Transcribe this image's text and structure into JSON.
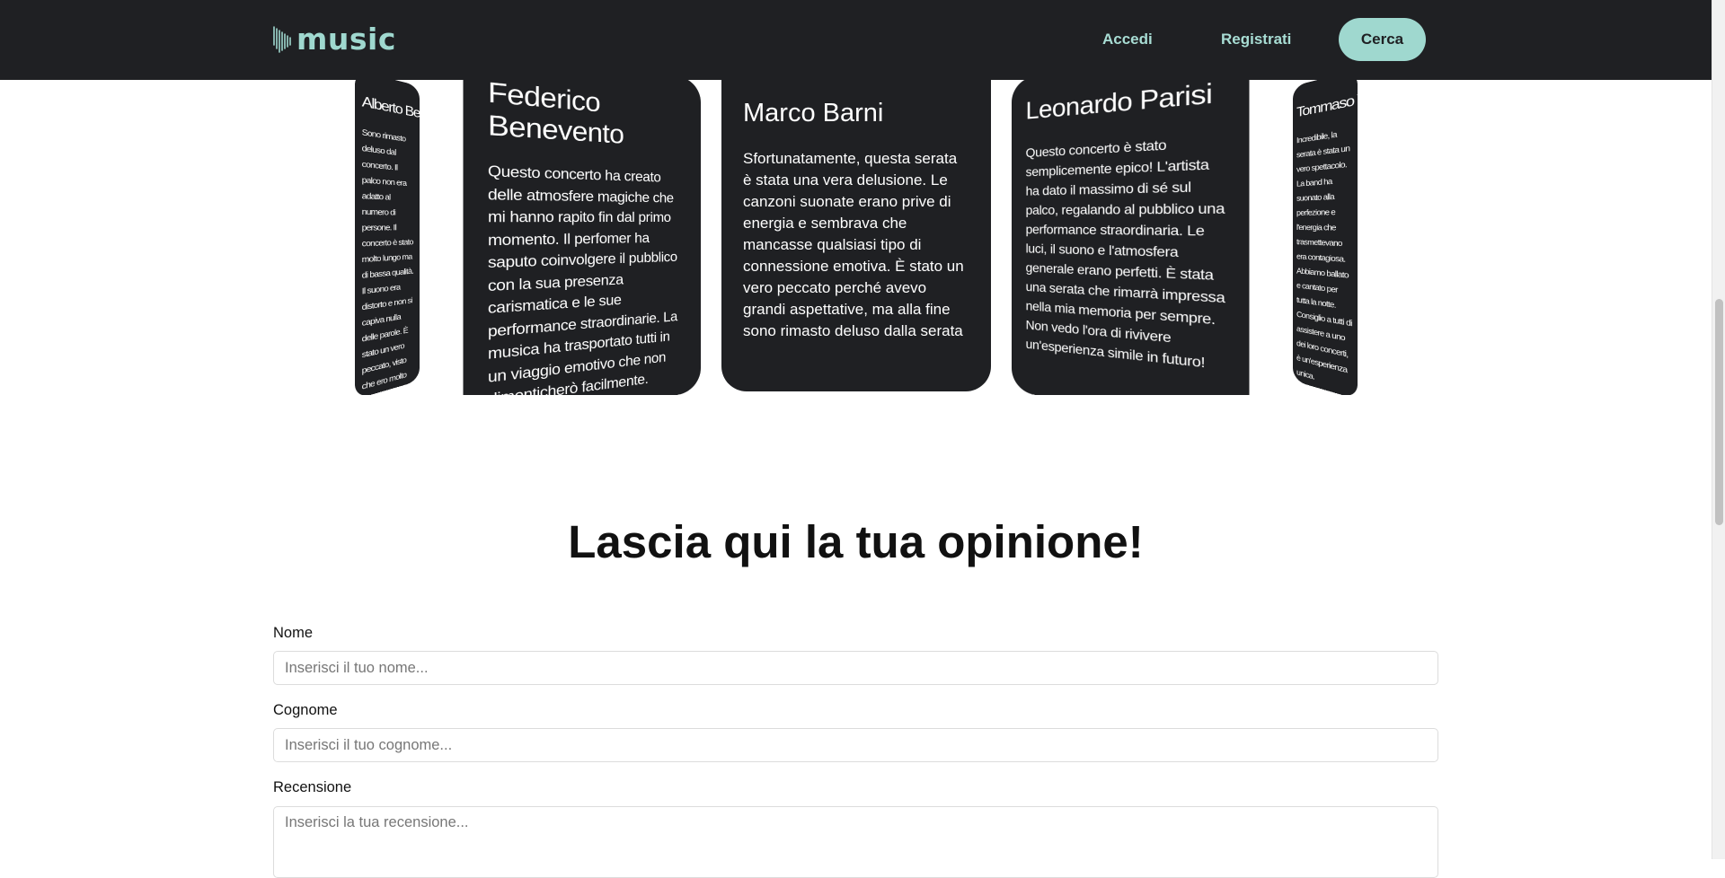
{
  "header": {
    "logo_text": "music",
    "logo_icon": "soundwave-icon",
    "nav_login": "Accedi",
    "nav_register": "Registrati",
    "search_button": "Cerca"
  },
  "reviews": [
    {
      "name": "Alberto Benvenuti",
      "text": "Sono rimasto deluso dal concerto. Il palco non era adatto al numero di persone. Il concerto è stato molto lungo ma di bassa qualità. Il suono era distorto e non si capiva nulla delle parole. È stato un vero peccato, visto che ero molto entusiasta di questo evento."
    },
    {
      "name": "Federico Benevento",
      "text": "Questo concerto ha creato delle atmosfere magiche che mi hanno rapito fin dal primo momento. Il perfomer ha saputo coinvolgere il pubblico con la sua presenza carismatica e le sue performance straordinarie. La musica ha trasportato tutti in un viaggio emotivo che non dimenticherò facilmente."
    },
    {
      "name": "Marco Barni",
      "text": "Sfortunatamente, questa serata è stata una vera delusione. Le canzoni suonate erano prive di energia e sembrava che mancasse qualsiasi tipo di connessione emotiva. È stato un vero peccato perché avevo grandi aspettative, ma alla fine sono rimasto deluso dalla serata"
    },
    {
      "name": "Leonardo Parisi",
      "text": "Questo concerto è stato semplicemente epico! L'artista ha dato il massimo di sé sul palco, regalando al pubblico una performance straordinaria. Le luci, il suono e l'atmosfera generale erano perfetti. È stata una serata che rimarrà impressa nella mia memoria per sempre. Non vedo l'ora di rivivere un'esperienza simile in futuro!"
    },
    {
      "name": "Tommaso Verdi",
      "text": "Incredibile, la serata è stata un vero spettacolo. La band ha suonato alla perfezione e l'energia che trasmettevano era contagiosa. Abbiamo ballato e cantato per tutta la notte. Consiglio a tutti di assistere a uno dei loro concerti, è un'esperienza unica."
    }
  ],
  "form": {
    "title": "Lascia qui la tua opinione!",
    "name_label": "Nome",
    "name_placeholder": "Inserisci il tuo nome...",
    "surname_label": "Cognome",
    "surname_placeholder": "Inserisci il tuo cognome...",
    "review_label": "Recensione",
    "review_placeholder": "Inserisci la tua recensione..."
  },
  "colors": {
    "dark": "#1f2023",
    "accent": "#9fd8cf"
  }
}
